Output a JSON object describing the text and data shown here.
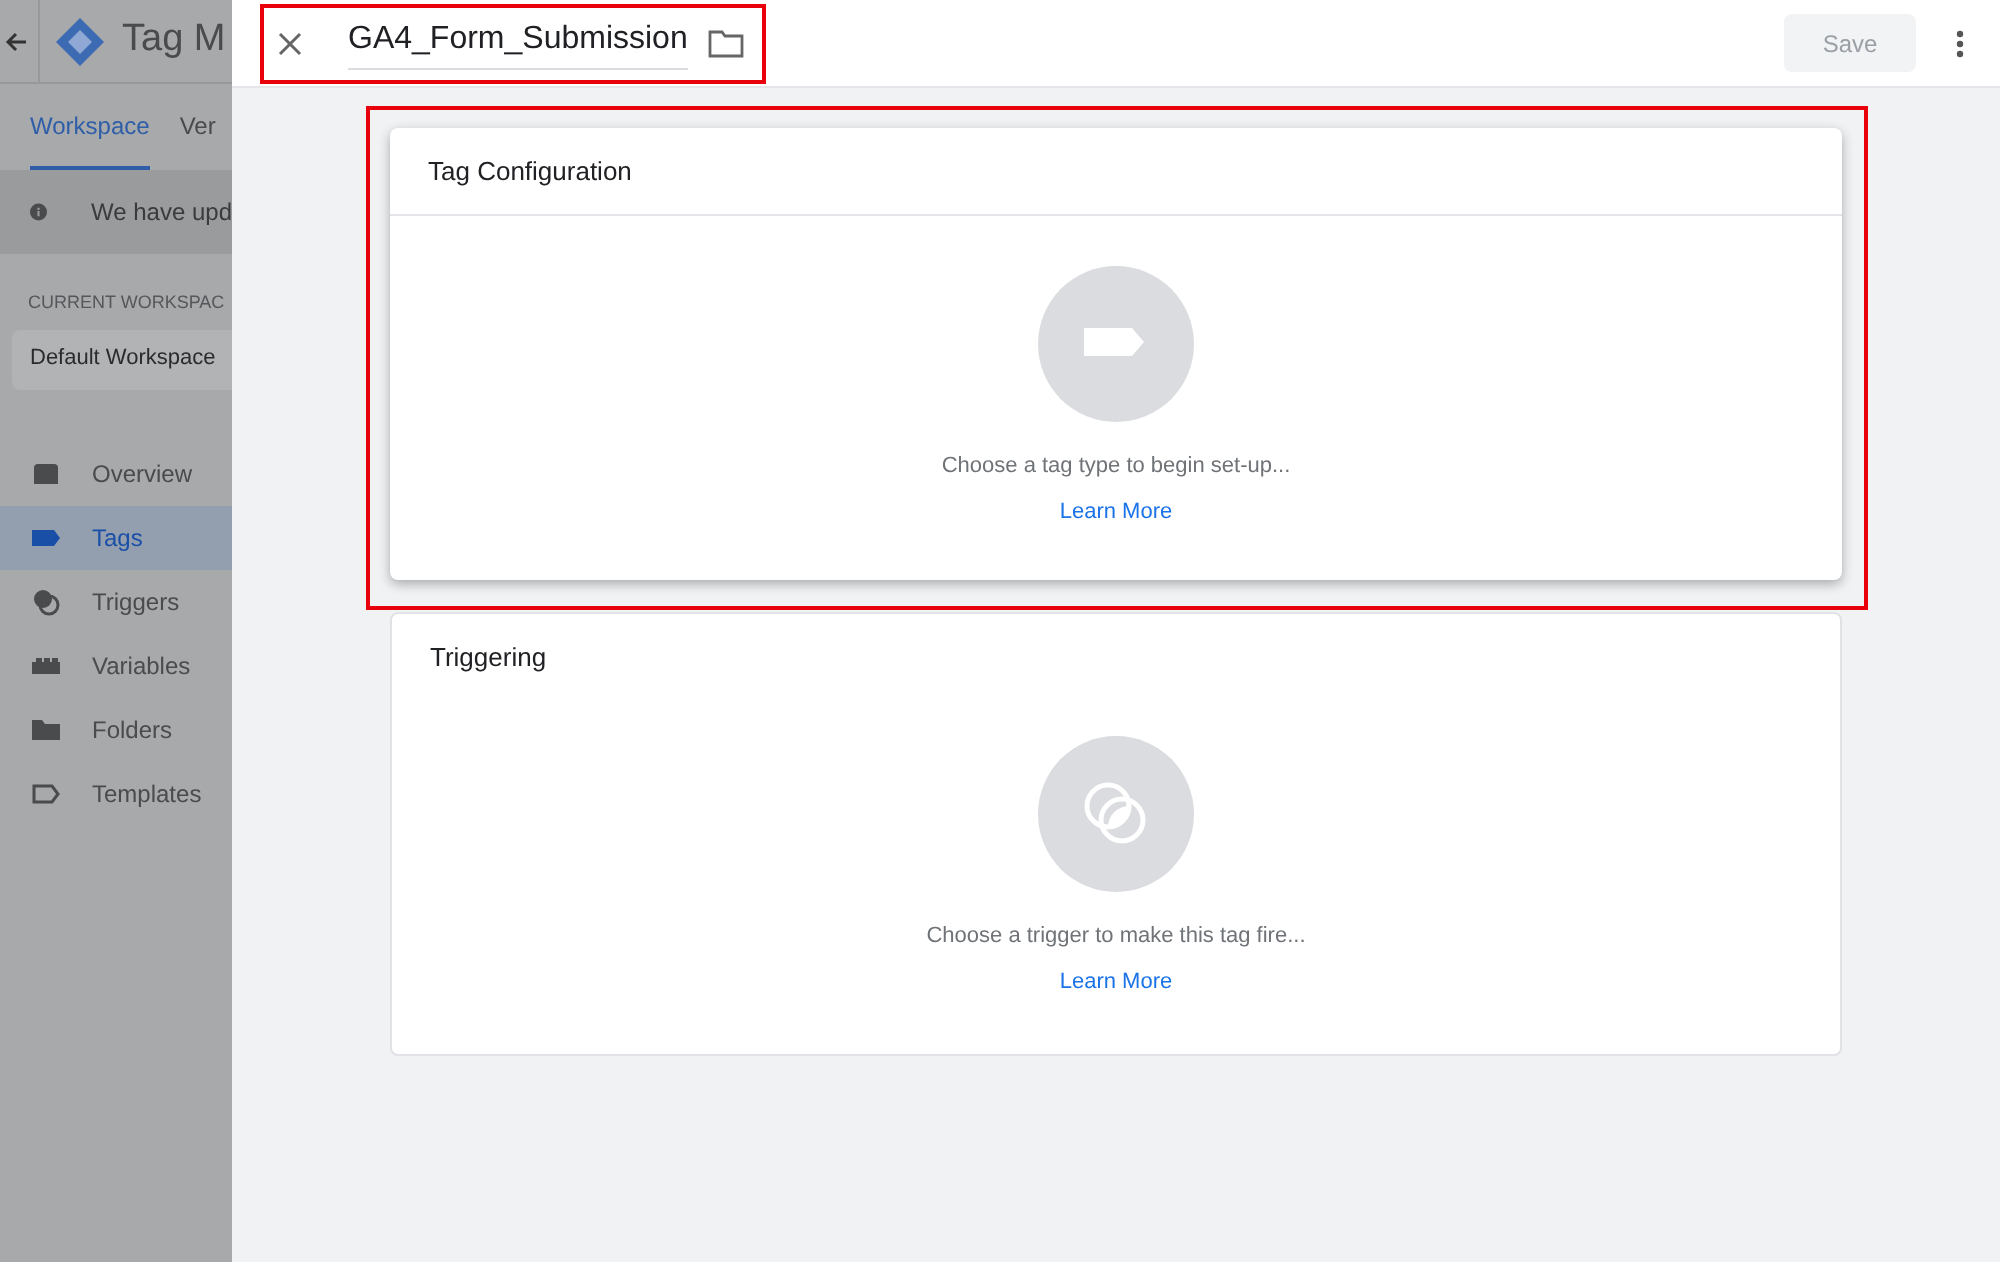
{
  "sidebar": {
    "app_title": "Tag M",
    "tabs": [
      {
        "label": "Workspace",
        "selected": true
      },
      {
        "label": "Ver",
        "selected": false
      }
    ],
    "banner": "We have upd",
    "workspace_label": "CURRENT WORKSPAC",
    "workspace": "Default Workspace",
    "items": [
      {
        "label": "Overview",
        "kind": "overview",
        "selected": false
      },
      {
        "label": "Tags",
        "kind": "tag",
        "selected": true
      },
      {
        "label": "Triggers",
        "kind": "trigger",
        "selected": false
      },
      {
        "label": "Variables",
        "kind": "variables",
        "selected": false
      },
      {
        "label": "Folders",
        "kind": "folder",
        "selected": false
      },
      {
        "label": "Templates",
        "kind": "template",
        "selected": false
      }
    ]
  },
  "editor": {
    "title": "GA4_Form_Submission",
    "save": {
      "label": "Save",
      "disabled": true
    },
    "sections": [
      {
        "kind": "tag",
        "title": "Tag Configuration",
        "hint": "Choose a tag type to begin set-up...",
        "link": "Learn More",
        "raised": true
      },
      {
        "kind": "trigger",
        "title": "Triggering",
        "hint": "Choose a trigger to make this tag fire...",
        "link": "Learn More",
        "raised": false
      }
    ]
  }
}
